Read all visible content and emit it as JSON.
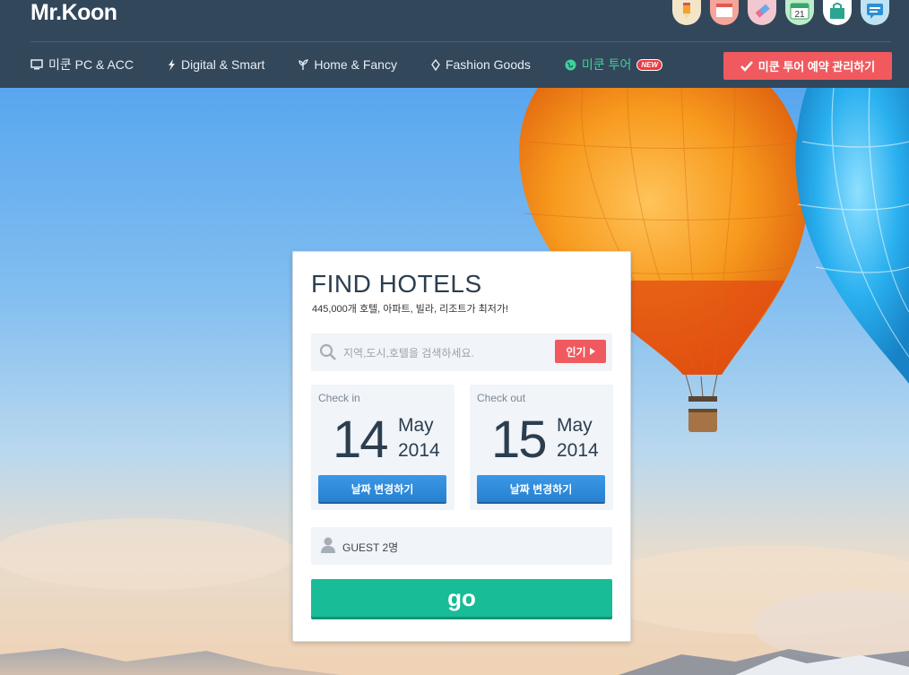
{
  "header": {
    "logo": "Mr.Koon",
    "icons": [
      {
        "name": "pencil-icon",
        "bg": "#f3e6c8"
      },
      {
        "name": "calendar-page-icon",
        "bg": "#f6a59b"
      },
      {
        "name": "eraser-icon",
        "bg": "#f3c7cf"
      },
      {
        "name": "calendar-icon",
        "bg": "#bdecc8",
        "text": "21"
      },
      {
        "name": "shopping-bag-icon",
        "bg": "#ffffff"
      },
      {
        "name": "chat-icon",
        "bg": "#bfe3f2"
      }
    ],
    "nav": [
      {
        "label": "미쿤 PC & ACC",
        "icon": "monitor-icon"
      },
      {
        "label": "Digital & Smart",
        "icon": "lightning-icon"
      },
      {
        "label": "Home & Fancy",
        "icon": "plant-icon"
      },
      {
        "label": "Fashion Goods",
        "icon": "diamond-icon"
      },
      {
        "label": "미쿤 투어",
        "icon": "globe-icon",
        "badge": "NEW"
      }
    ],
    "manage_button": "미쿤 투어 예약 관리하기"
  },
  "card": {
    "title": "FIND HOTELS",
    "subtitle": "445,000개 호텔, 아파트, 빌라, 리조트가 최저가!",
    "search": {
      "placeholder": "지역,도시,호텔을 검색하세요.",
      "popular_label": "인기"
    },
    "check_in": {
      "label": "Check in",
      "day": "14",
      "month": "May",
      "year": "2014",
      "button": "날짜 변경하기"
    },
    "check_out": {
      "label": "Check out",
      "day": "15",
      "month": "May",
      "year": "2014",
      "button": "날짜 변경하기"
    },
    "guest": "GUEST 2명",
    "go": "go"
  },
  "colors": {
    "header_bg": "#33475b",
    "accent_red": "#f05a5f",
    "accent_blue": "#2f8bdb",
    "accent_green": "#18bc96",
    "tour_green": "#3fd19b",
    "title_navy": "#2b3e50"
  }
}
